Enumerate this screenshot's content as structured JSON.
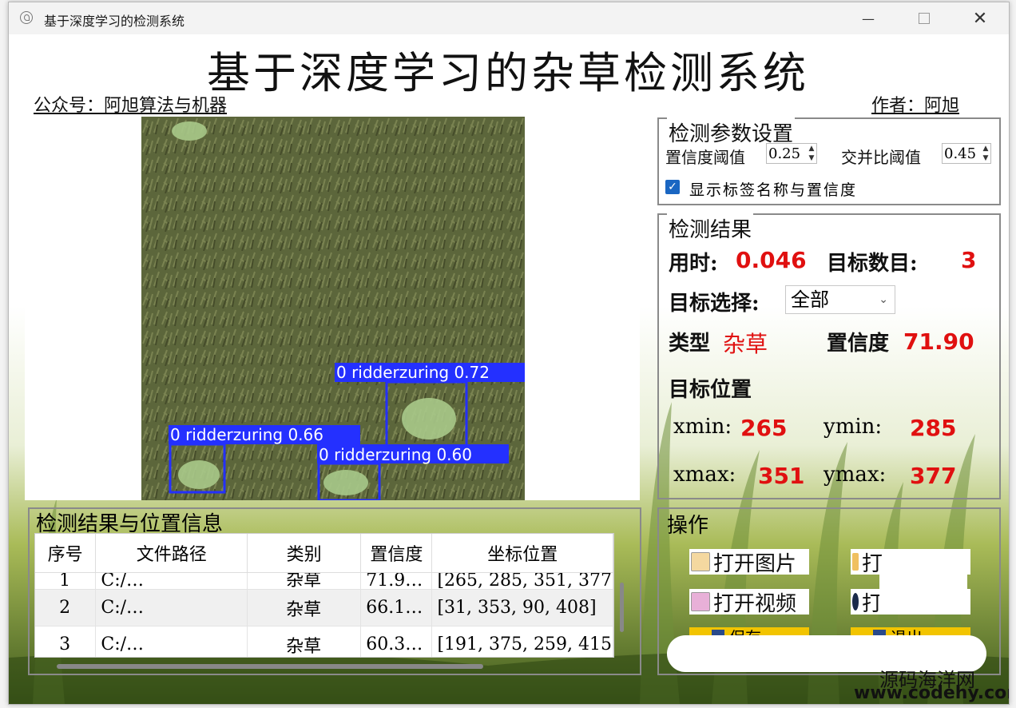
{
  "window": {
    "title": "基于深度学习的检测系统"
  },
  "header": {
    "title": "基于深度学习的杂草检测系统",
    "wechat": "公众号：阿旭算法与机器",
    "author": "作者：阿旭"
  },
  "image": {
    "detections": [
      {
        "label": "0 ridderzuring 0.72"
      },
      {
        "label": "0 ridderzuring 0.66"
      },
      {
        "label": "0 ridderzuring 0.60"
      }
    ]
  },
  "params": {
    "title": "检测参数设置",
    "conf_label": "置信度阈值",
    "conf_value": "0.25",
    "iou_label": "交并比阈值",
    "iou_value": "0.45",
    "show_label_text": "显示标签名称与置信度",
    "show_label_checked": true
  },
  "result": {
    "title": "检测结果",
    "time_label": "用时:",
    "time_value": "0.046",
    "count_label": "目标数目:",
    "count_value": "3",
    "select_label": "目标选择:",
    "select_value": "全部",
    "type_label": "类型",
    "type_value": "杂草",
    "conf_label": "置信度",
    "conf_value": "71.90",
    "pos_label": "目标位置",
    "xmin_label": "xmin:",
    "xmin_value": "265",
    "ymin_label": "ymin:",
    "ymin_value": "285",
    "xmax_label": "xmax:",
    "xmax_value": "351",
    "ymax_label": "ymax:",
    "ymax_value": "377"
  },
  "table": {
    "title": "检测结果与位置信息",
    "headers": [
      "序号",
      "文件路径",
      "类别",
      "置信度",
      "坐标位置"
    ],
    "rows": [
      [
        "1",
        "C:/…",
        "杂草",
        "71.9…",
        "[265, 285, 351, 377"
      ],
      [
        "2",
        "C:/…",
        "杂草",
        "66.1…",
        "[31, 353, 90, 408]"
      ],
      [
        "3",
        "C:/…",
        "杂草",
        "60.3…",
        "[191, 375, 259, 415"
      ]
    ]
  },
  "ops": {
    "title": "操作",
    "open_image": "打开图片",
    "open_folder": "打开文件",
    "open_video": "打开视频",
    "open_camera": "打",
    "save": "保存",
    "exit": "退出"
  },
  "watermark": {
    "cn": "源码海洋网",
    "url": "www.codehy.com"
  }
}
